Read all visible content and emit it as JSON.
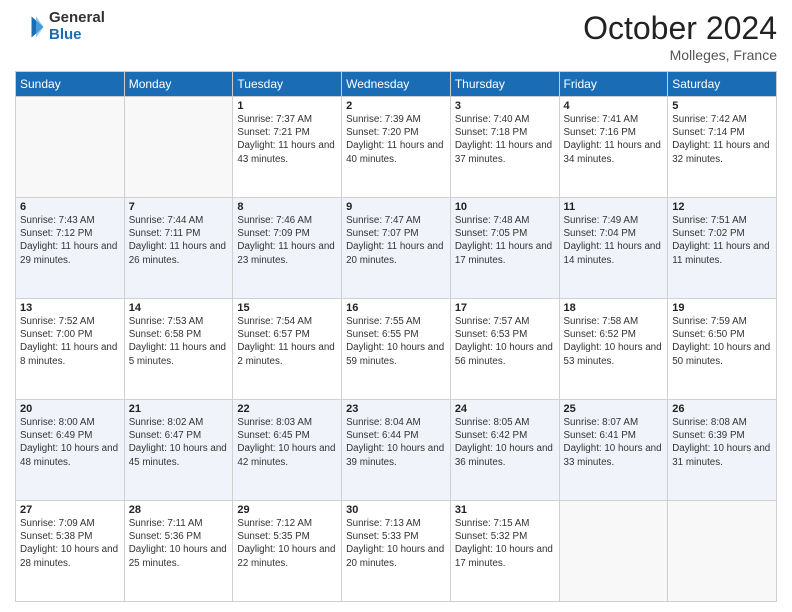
{
  "header": {
    "logo_general": "General",
    "logo_blue": "Blue",
    "month_title": "October 2024",
    "location": "Molleges, France"
  },
  "days_of_week": [
    "Sunday",
    "Monday",
    "Tuesday",
    "Wednesday",
    "Thursday",
    "Friday",
    "Saturday"
  ],
  "weeks": [
    [
      {
        "day": "",
        "empty": true
      },
      {
        "day": "",
        "empty": true
      },
      {
        "day": "1",
        "sunrise": "7:37 AM",
        "sunset": "7:21 PM",
        "daylight": "11 hours and 43 minutes."
      },
      {
        "day": "2",
        "sunrise": "7:39 AM",
        "sunset": "7:20 PM",
        "daylight": "11 hours and 40 minutes."
      },
      {
        "day": "3",
        "sunrise": "7:40 AM",
        "sunset": "7:18 PM",
        "daylight": "11 hours and 37 minutes."
      },
      {
        "day": "4",
        "sunrise": "7:41 AM",
        "sunset": "7:16 PM",
        "daylight": "11 hours and 34 minutes."
      },
      {
        "day": "5",
        "sunrise": "7:42 AM",
        "sunset": "7:14 PM",
        "daylight": "11 hours and 32 minutes."
      }
    ],
    [
      {
        "day": "6",
        "sunrise": "7:43 AM",
        "sunset": "7:12 PM",
        "daylight": "11 hours and 29 minutes."
      },
      {
        "day": "7",
        "sunrise": "7:44 AM",
        "sunset": "7:11 PM",
        "daylight": "11 hours and 26 minutes."
      },
      {
        "day": "8",
        "sunrise": "7:46 AM",
        "sunset": "7:09 PM",
        "daylight": "11 hours and 23 minutes."
      },
      {
        "day": "9",
        "sunrise": "7:47 AM",
        "sunset": "7:07 PM",
        "daylight": "11 hours and 20 minutes."
      },
      {
        "day": "10",
        "sunrise": "7:48 AM",
        "sunset": "7:05 PM",
        "daylight": "11 hours and 17 minutes."
      },
      {
        "day": "11",
        "sunrise": "7:49 AM",
        "sunset": "7:04 PM",
        "daylight": "11 hours and 14 minutes."
      },
      {
        "day": "12",
        "sunrise": "7:51 AM",
        "sunset": "7:02 PM",
        "daylight": "11 hours and 11 minutes."
      }
    ],
    [
      {
        "day": "13",
        "sunrise": "7:52 AM",
        "sunset": "7:00 PM",
        "daylight": "11 hours and 8 minutes."
      },
      {
        "day": "14",
        "sunrise": "7:53 AM",
        "sunset": "6:58 PM",
        "daylight": "11 hours and 5 minutes."
      },
      {
        "day": "15",
        "sunrise": "7:54 AM",
        "sunset": "6:57 PM",
        "daylight": "11 hours and 2 minutes."
      },
      {
        "day": "16",
        "sunrise": "7:55 AM",
        "sunset": "6:55 PM",
        "daylight": "10 hours and 59 minutes."
      },
      {
        "day": "17",
        "sunrise": "7:57 AM",
        "sunset": "6:53 PM",
        "daylight": "10 hours and 56 minutes."
      },
      {
        "day": "18",
        "sunrise": "7:58 AM",
        "sunset": "6:52 PM",
        "daylight": "10 hours and 53 minutes."
      },
      {
        "day": "19",
        "sunrise": "7:59 AM",
        "sunset": "6:50 PM",
        "daylight": "10 hours and 50 minutes."
      }
    ],
    [
      {
        "day": "20",
        "sunrise": "8:00 AM",
        "sunset": "6:49 PM",
        "daylight": "10 hours and 48 minutes."
      },
      {
        "day": "21",
        "sunrise": "8:02 AM",
        "sunset": "6:47 PM",
        "daylight": "10 hours and 45 minutes."
      },
      {
        "day": "22",
        "sunrise": "8:03 AM",
        "sunset": "6:45 PM",
        "daylight": "10 hours and 42 minutes."
      },
      {
        "day": "23",
        "sunrise": "8:04 AM",
        "sunset": "6:44 PM",
        "daylight": "10 hours and 39 minutes."
      },
      {
        "day": "24",
        "sunrise": "8:05 AM",
        "sunset": "6:42 PM",
        "daylight": "10 hours and 36 minutes."
      },
      {
        "day": "25",
        "sunrise": "8:07 AM",
        "sunset": "6:41 PM",
        "daylight": "10 hours and 33 minutes."
      },
      {
        "day": "26",
        "sunrise": "8:08 AM",
        "sunset": "6:39 PM",
        "daylight": "10 hours and 31 minutes."
      }
    ],
    [
      {
        "day": "27",
        "sunrise": "7:09 AM",
        "sunset": "5:38 PM",
        "daylight": "10 hours and 28 minutes."
      },
      {
        "day": "28",
        "sunrise": "7:11 AM",
        "sunset": "5:36 PM",
        "daylight": "10 hours and 25 minutes."
      },
      {
        "day": "29",
        "sunrise": "7:12 AM",
        "sunset": "5:35 PM",
        "daylight": "10 hours and 22 minutes."
      },
      {
        "day": "30",
        "sunrise": "7:13 AM",
        "sunset": "5:33 PM",
        "daylight": "10 hours and 20 minutes."
      },
      {
        "day": "31",
        "sunrise": "7:15 AM",
        "sunset": "5:32 PM",
        "daylight": "10 hours and 17 minutes."
      },
      {
        "day": "",
        "empty": true
      },
      {
        "day": "",
        "empty": true
      }
    ]
  ]
}
